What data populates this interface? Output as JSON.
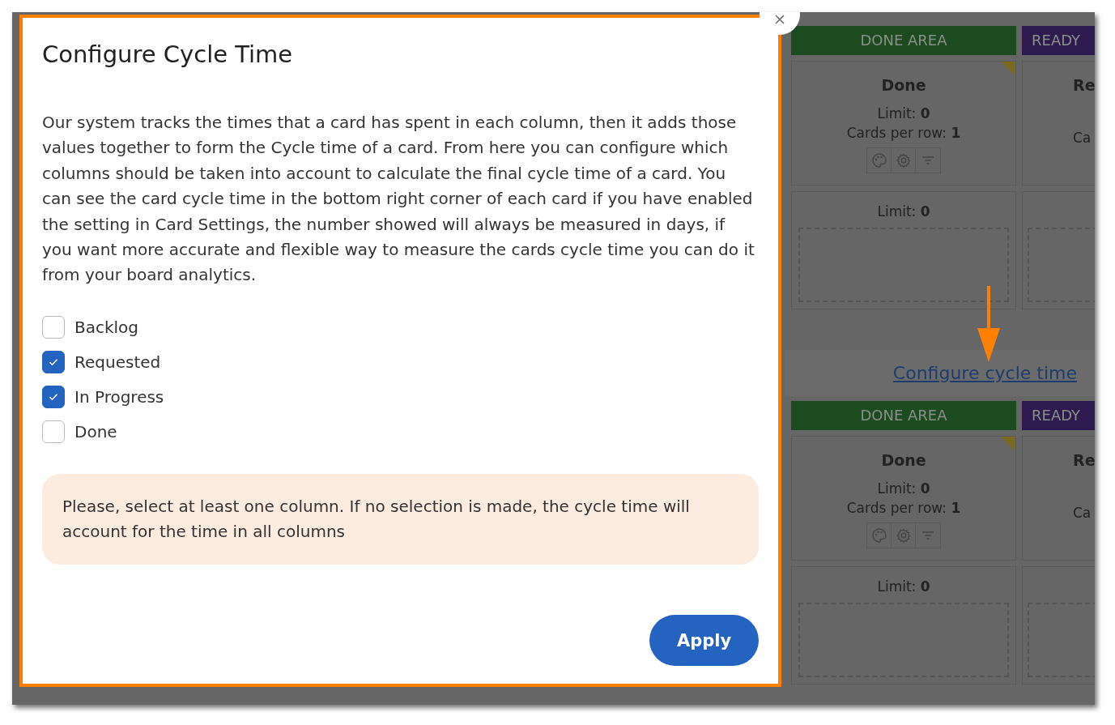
{
  "dialog": {
    "title": "Configure Cycle Time",
    "description": "Our system tracks the times that a card has spent in each column, then it adds those values together to form the Cycle time of a card. From here you can configure which columns should be taken into account to calculate the final cycle time of a card. You can see the card cycle time in the bottom right corner of each card if you have enabled the setting in Card Settings, the number showed will always be measured in days, if you want more accurate and flexible way to measure the cards cycle time you can do it from your board analytics.",
    "columns": [
      {
        "label": "Backlog",
        "checked": false
      },
      {
        "label": "Requested",
        "checked": true
      },
      {
        "label": "In Progress",
        "checked": true
      },
      {
        "label": "Done",
        "checked": false
      }
    ],
    "notice": "Please, select at least one column. If no selection is made, the cycle time will account for the time in all columns",
    "apply_button": "Apply"
  },
  "board": {
    "sections": [
      {
        "lanes": [
          {
            "header": "DONE AREA",
            "color": "#1c4b1f",
            "title": "Done",
            "limit": "Limit: **0**",
            "per_row": "Cards per row: **1**",
            "tools": true,
            "sub_limit": "Limit: **0**"
          },
          {
            "header": "READY",
            "color": "#2d1a4f",
            "title": "Re",
            "per_row": "Ca",
            "tools": false
          }
        ]
      },
      {
        "link": "Configure cycle time",
        "lanes": [
          {
            "header": "DONE AREA",
            "color": "#1c4b1f",
            "title": "Done",
            "limit": "Limit: **0**",
            "per_row": "Cards per row: **1**",
            "tools": true,
            "sub_limit": "Limit: **0**"
          },
          {
            "header": "READY",
            "color": "#2d1a4f",
            "title": "Re",
            "per_row": "Ca",
            "tools": false
          }
        ]
      }
    ]
  }
}
